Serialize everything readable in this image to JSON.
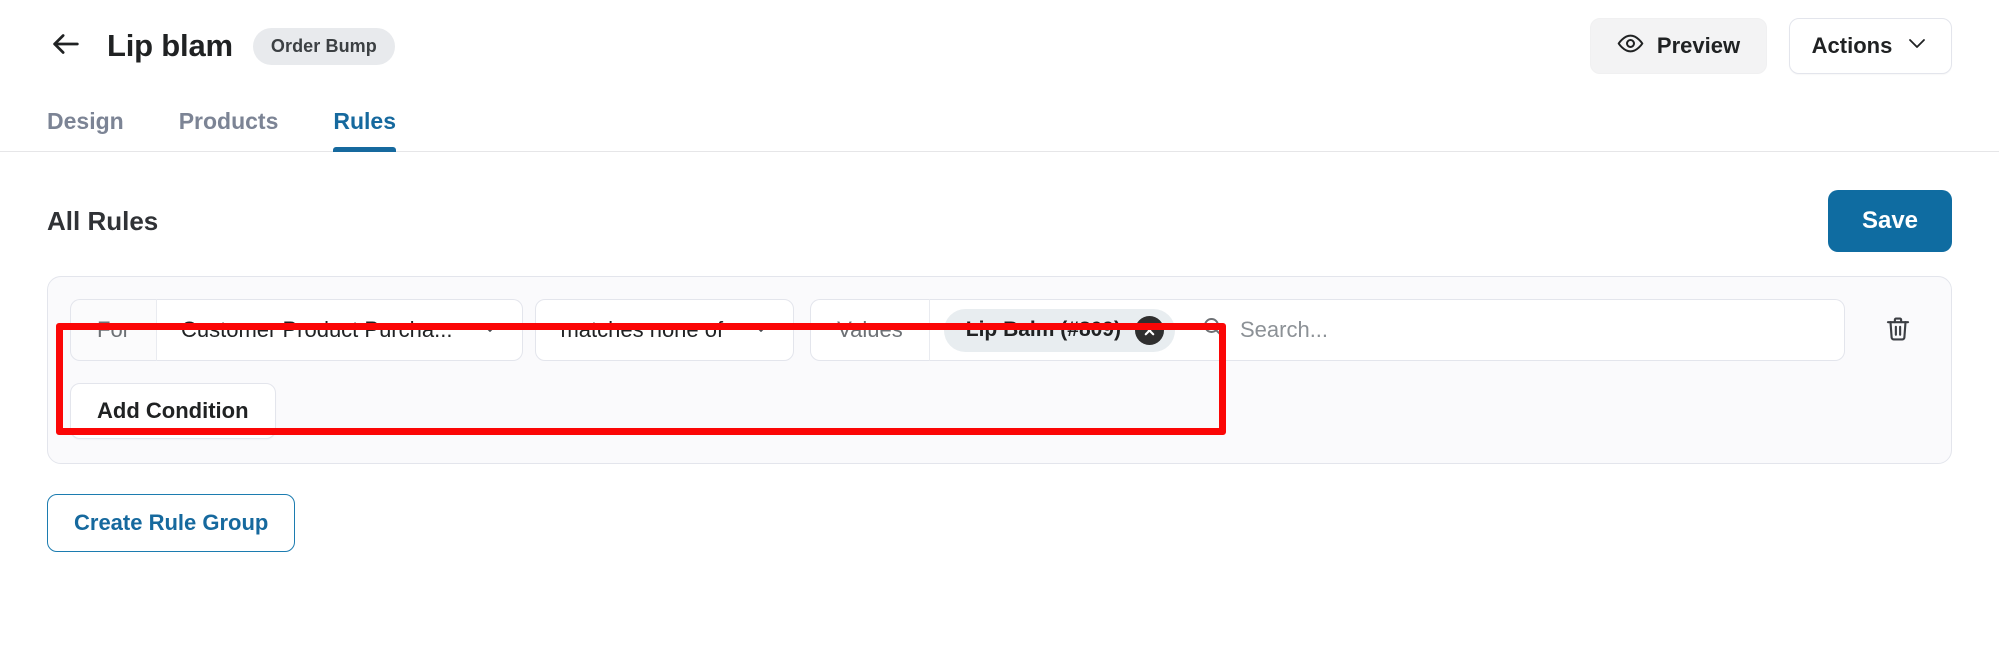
{
  "header": {
    "back_icon": "arrow-left-icon",
    "title": "Lip blam",
    "badge": "Order Bump",
    "preview_button": {
      "label": "Preview",
      "icon": "eye-icon"
    },
    "actions_button": {
      "label": "Actions",
      "icon": "chevron-down-icon"
    }
  },
  "tabs": [
    {
      "label": "Design",
      "active": false
    },
    {
      "label": "Products",
      "active": false
    },
    {
      "label": "Rules",
      "active": true
    }
  ],
  "section": {
    "title": "All Rules",
    "save_label": "Save",
    "save_color": "#0f6ca1"
  },
  "rule": {
    "for_label": "For",
    "subject": "Customer Product Purcha...",
    "operator": "matches none of",
    "values_label": "Values",
    "chips": [
      {
        "label": "Lip Balm (#809)",
        "remove_icon": "close-circle-icon"
      }
    ],
    "search_placeholder": "Search...",
    "search_value": "",
    "search_icon": "search-icon",
    "delete_icon": "trash-icon",
    "add_condition_label": "Add Condition"
  },
  "create_rule_group_label": "Create Rule Group",
  "annotation": {
    "color": "#fb0606"
  }
}
